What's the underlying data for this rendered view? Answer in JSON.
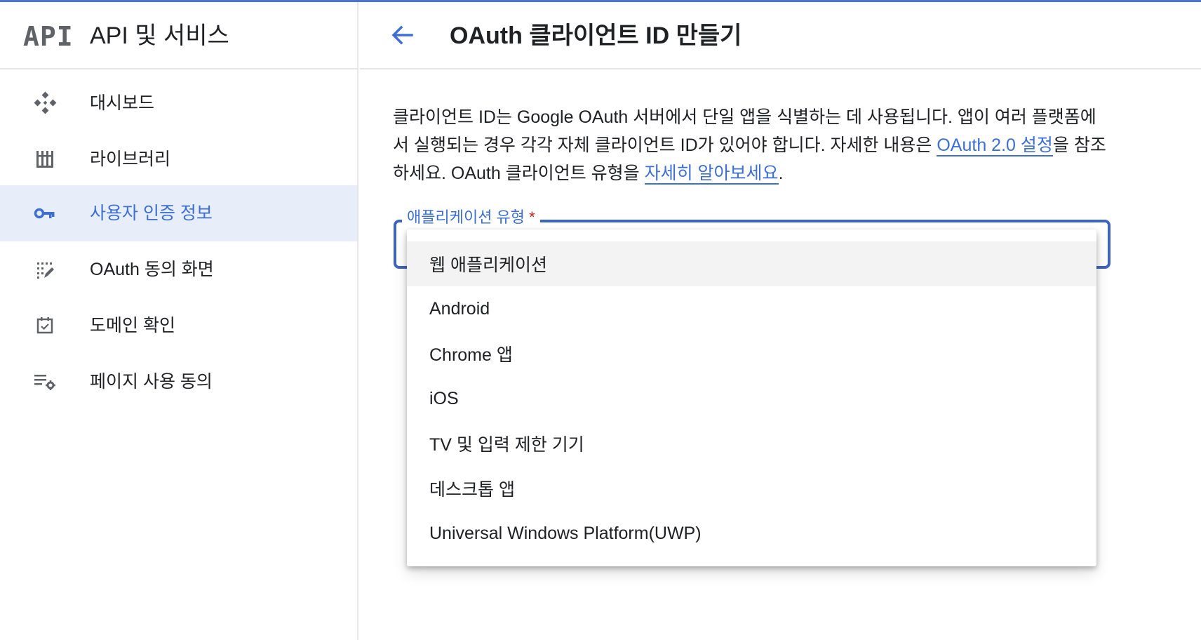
{
  "sidebar": {
    "logo": "API",
    "title": "API 및 서비스",
    "items": [
      {
        "label": "대시보드",
        "icon": "dashboard-icon",
        "active": false
      },
      {
        "label": "라이브러리",
        "icon": "library-icon",
        "active": false
      },
      {
        "label": "사용자 인증 정보",
        "icon": "key-icon",
        "active": true
      },
      {
        "label": "OAuth 동의 화면",
        "icon": "consent-screen-icon",
        "active": false
      },
      {
        "label": "도메인 확인",
        "icon": "checkbox-icon",
        "active": false
      },
      {
        "label": "페이지 사용 동의",
        "icon": "settings-list-icon",
        "active": false
      }
    ]
  },
  "header": {
    "title": "OAuth 클라이언트 ID 만들기"
  },
  "description": {
    "text_1": "클라이언트 ID는 Google OAuth 서버에서 단일 앱을 식별하는 데 사용됩니다. 앱이 여러 플랫폼에서 실행되는 경우 각각 자체 클라이언트 ID가 있어야 합니다. 자세한 내용은 ",
    "link_1": "OAuth 2.0 설정",
    "text_2": "을 참조하세요. OAuth 클라이언트 유형을 ",
    "link_2": "자세히 알아보세요",
    "text_3": "."
  },
  "form": {
    "app_type_label": "애플리케이션 유형",
    "required_mark": "*",
    "options": [
      "웹 애플리케이션",
      "Android",
      "Chrome 앱",
      "iOS",
      "TV 및 입력 제한 기기",
      "데스크톱 앱",
      "Universal Windows Platform(UWP)"
    ],
    "highlighted_option": 0
  },
  "colors": {
    "accent": "#3d6fd3",
    "active_bg": "#e8eef9",
    "field_border": "#3d63c9",
    "required": "#c5221f"
  }
}
